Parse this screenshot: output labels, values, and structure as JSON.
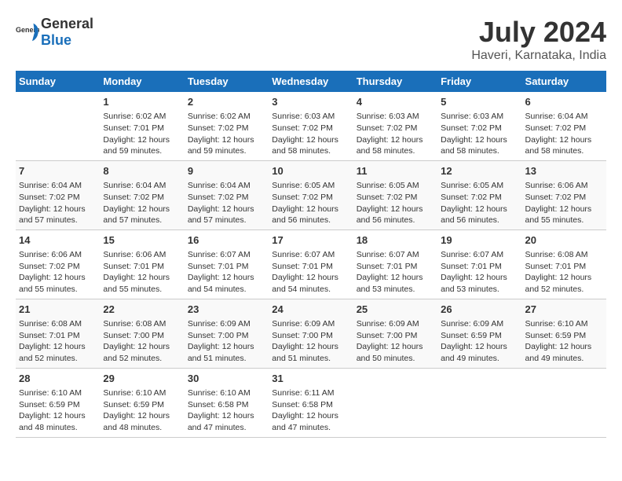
{
  "header": {
    "logo_general": "General",
    "logo_blue": "Blue",
    "title": "July 2024",
    "subtitle": "Haveri, Karnataka, India"
  },
  "calendar": {
    "days_of_week": [
      "Sunday",
      "Monday",
      "Tuesday",
      "Wednesday",
      "Thursday",
      "Friday",
      "Saturday"
    ],
    "weeks": [
      [
        {
          "day": "",
          "sunrise": "",
          "sunset": "",
          "daylight": ""
        },
        {
          "day": "1",
          "sunrise": "Sunrise: 6:02 AM",
          "sunset": "Sunset: 7:01 PM",
          "daylight": "Daylight: 12 hours and 59 minutes."
        },
        {
          "day": "2",
          "sunrise": "Sunrise: 6:02 AM",
          "sunset": "Sunset: 7:02 PM",
          "daylight": "Daylight: 12 hours and 59 minutes."
        },
        {
          "day": "3",
          "sunrise": "Sunrise: 6:03 AM",
          "sunset": "Sunset: 7:02 PM",
          "daylight": "Daylight: 12 hours and 58 minutes."
        },
        {
          "day": "4",
          "sunrise": "Sunrise: 6:03 AM",
          "sunset": "Sunset: 7:02 PM",
          "daylight": "Daylight: 12 hours and 58 minutes."
        },
        {
          "day": "5",
          "sunrise": "Sunrise: 6:03 AM",
          "sunset": "Sunset: 7:02 PM",
          "daylight": "Daylight: 12 hours and 58 minutes."
        },
        {
          "day": "6",
          "sunrise": "Sunrise: 6:04 AM",
          "sunset": "Sunset: 7:02 PM",
          "daylight": "Daylight: 12 hours and 58 minutes."
        }
      ],
      [
        {
          "day": "7",
          "sunrise": "Sunrise: 6:04 AM",
          "sunset": "Sunset: 7:02 PM",
          "daylight": "Daylight: 12 hours and 57 minutes."
        },
        {
          "day": "8",
          "sunrise": "Sunrise: 6:04 AM",
          "sunset": "Sunset: 7:02 PM",
          "daylight": "Daylight: 12 hours and 57 minutes."
        },
        {
          "day": "9",
          "sunrise": "Sunrise: 6:04 AM",
          "sunset": "Sunset: 7:02 PM",
          "daylight": "Daylight: 12 hours and 57 minutes."
        },
        {
          "day": "10",
          "sunrise": "Sunrise: 6:05 AM",
          "sunset": "Sunset: 7:02 PM",
          "daylight": "Daylight: 12 hours and 56 minutes."
        },
        {
          "day": "11",
          "sunrise": "Sunrise: 6:05 AM",
          "sunset": "Sunset: 7:02 PM",
          "daylight": "Daylight: 12 hours and 56 minutes."
        },
        {
          "day": "12",
          "sunrise": "Sunrise: 6:05 AM",
          "sunset": "Sunset: 7:02 PM",
          "daylight": "Daylight: 12 hours and 56 minutes."
        },
        {
          "day": "13",
          "sunrise": "Sunrise: 6:06 AM",
          "sunset": "Sunset: 7:02 PM",
          "daylight": "Daylight: 12 hours and 55 minutes."
        }
      ],
      [
        {
          "day": "14",
          "sunrise": "Sunrise: 6:06 AM",
          "sunset": "Sunset: 7:02 PM",
          "daylight": "Daylight: 12 hours and 55 minutes."
        },
        {
          "day": "15",
          "sunrise": "Sunrise: 6:06 AM",
          "sunset": "Sunset: 7:01 PM",
          "daylight": "Daylight: 12 hours and 55 minutes."
        },
        {
          "day": "16",
          "sunrise": "Sunrise: 6:07 AM",
          "sunset": "Sunset: 7:01 PM",
          "daylight": "Daylight: 12 hours and 54 minutes."
        },
        {
          "day": "17",
          "sunrise": "Sunrise: 6:07 AM",
          "sunset": "Sunset: 7:01 PM",
          "daylight": "Daylight: 12 hours and 54 minutes."
        },
        {
          "day": "18",
          "sunrise": "Sunrise: 6:07 AM",
          "sunset": "Sunset: 7:01 PM",
          "daylight": "Daylight: 12 hours and 53 minutes."
        },
        {
          "day": "19",
          "sunrise": "Sunrise: 6:07 AM",
          "sunset": "Sunset: 7:01 PM",
          "daylight": "Daylight: 12 hours and 53 minutes."
        },
        {
          "day": "20",
          "sunrise": "Sunrise: 6:08 AM",
          "sunset": "Sunset: 7:01 PM",
          "daylight": "Daylight: 12 hours and 52 minutes."
        }
      ],
      [
        {
          "day": "21",
          "sunrise": "Sunrise: 6:08 AM",
          "sunset": "Sunset: 7:01 PM",
          "daylight": "Daylight: 12 hours and 52 minutes."
        },
        {
          "day": "22",
          "sunrise": "Sunrise: 6:08 AM",
          "sunset": "Sunset: 7:00 PM",
          "daylight": "Daylight: 12 hours and 52 minutes."
        },
        {
          "day": "23",
          "sunrise": "Sunrise: 6:09 AM",
          "sunset": "Sunset: 7:00 PM",
          "daylight": "Daylight: 12 hours and 51 minutes."
        },
        {
          "day": "24",
          "sunrise": "Sunrise: 6:09 AM",
          "sunset": "Sunset: 7:00 PM",
          "daylight": "Daylight: 12 hours and 51 minutes."
        },
        {
          "day": "25",
          "sunrise": "Sunrise: 6:09 AM",
          "sunset": "Sunset: 7:00 PM",
          "daylight": "Daylight: 12 hours and 50 minutes."
        },
        {
          "day": "26",
          "sunrise": "Sunrise: 6:09 AM",
          "sunset": "Sunset: 6:59 PM",
          "daylight": "Daylight: 12 hours and 49 minutes."
        },
        {
          "day": "27",
          "sunrise": "Sunrise: 6:10 AM",
          "sunset": "Sunset: 6:59 PM",
          "daylight": "Daylight: 12 hours and 49 minutes."
        }
      ],
      [
        {
          "day": "28",
          "sunrise": "Sunrise: 6:10 AM",
          "sunset": "Sunset: 6:59 PM",
          "daylight": "Daylight: 12 hours and 48 minutes."
        },
        {
          "day": "29",
          "sunrise": "Sunrise: 6:10 AM",
          "sunset": "Sunset: 6:59 PM",
          "daylight": "Daylight: 12 hours and 48 minutes."
        },
        {
          "day": "30",
          "sunrise": "Sunrise: 6:10 AM",
          "sunset": "Sunset: 6:58 PM",
          "daylight": "Daylight: 12 hours and 47 minutes."
        },
        {
          "day": "31",
          "sunrise": "Sunrise: 6:11 AM",
          "sunset": "Sunset: 6:58 PM",
          "daylight": "Daylight: 12 hours and 47 minutes."
        },
        {
          "day": "",
          "sunrise": "",
          "sunset": "",
          "daylight": ""
        },
        {
          "day": "",
          "sunrise": "",
          "sunset": "",
          "daylight": ""
        },
        {
          "day": "",
          "sunrise": "",
          "sunset": "",
          "daylight": ""
        }
      ]
    ]
  }
}
